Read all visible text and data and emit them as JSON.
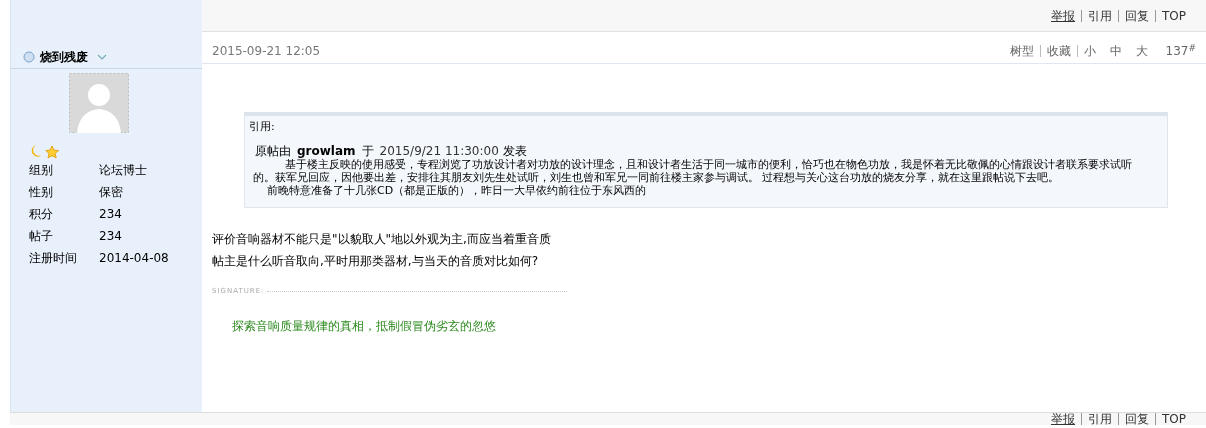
{
  "top_actions": [
    {
      "label": "举报",
      "underlined": true
    },
    {
      "label": "引用",
      "underlined": false
    },
    {
      "label": "回复",
      "underlined": false
    },
    {
      "label": "TOP",
      "underlined": false
    }
  ],
  "author": {
    "name": "烧到残废",
    "online": false,
    "fields": [
      {
        "label": "组别",
        "value": "论坛博士"
      },
      {
        "label": "性别",
        "value": "保密"
      },
      {
        "label": "积分",
        "value": "234"
      },
      {
        "label": "帖子",
        "value": "234"
      },
      {
        "label": "注册时间",
        "value": "2014-04-08"
      }
    ]
  },
  "post": {
    "date": "2015-09-21 12:05",
    "tools": [
      {
        "label": "树型",
        "kind": "link"
      },
      {
        "label": "收藏",
        "kind": "link"
      },
      {
        "label": "小",
        "kind": "size"
      },
      {
        "label": "中",
        "kind": "size"
      },
      {
        "label": "大",
        "kind": "size"
      }
    ],
    "floor": "137",
    "floor_mark": "#",
    "quote": {
      "title": "引用:",
      "lead": "原帖由",
      "user": "growlam",
      "at": "于",
      "time": "2015/9/21 11:30:00",
      "posted": "发表",
      "paragraphs": [
        "基于楼主反映的使用感受，专程浏览了功放设计者对功放的设计理念，且和设计者生活于同一城市的便利，恰巧也在物色功放，我是怀着无比敬佩的心情跟设计者联系要求试听的。获军兄回应，因他要出差，安排往其朋友刘先生处试听，刘生也曾和军兄一同前往楼主家参与调试。 过程想与关心这台功放的烧友分享，就在这里跟帖说下去吧。",
        "前晚特意准备了十几张CD（都是正版的），昨日一大早依约前往位于东风西的"
      ]
    },
    "body": [
      "评价音响器材不能只是\"以貌取人\"地以外观为主,而应当着重音质",
      "帖主是什么听音取向,平时用那类器材,与当天的音质对比如何?"
    ],
    "signature_label": "SIGNATURE:",
    "signature": "探索音响质量规律的真相，抵制假冒伪劣玄的忽悠"
  },
  "bottom_actions": [
    {
      "label": "举报",
      "underlined": true
    },
    {
      "label": "引用",
      "underlined": false
    },
    {
      "label": "回复",
      "underlined": false
    },
    {
      "label": "TOP",
      "underlined": false
    }
  ]
}
